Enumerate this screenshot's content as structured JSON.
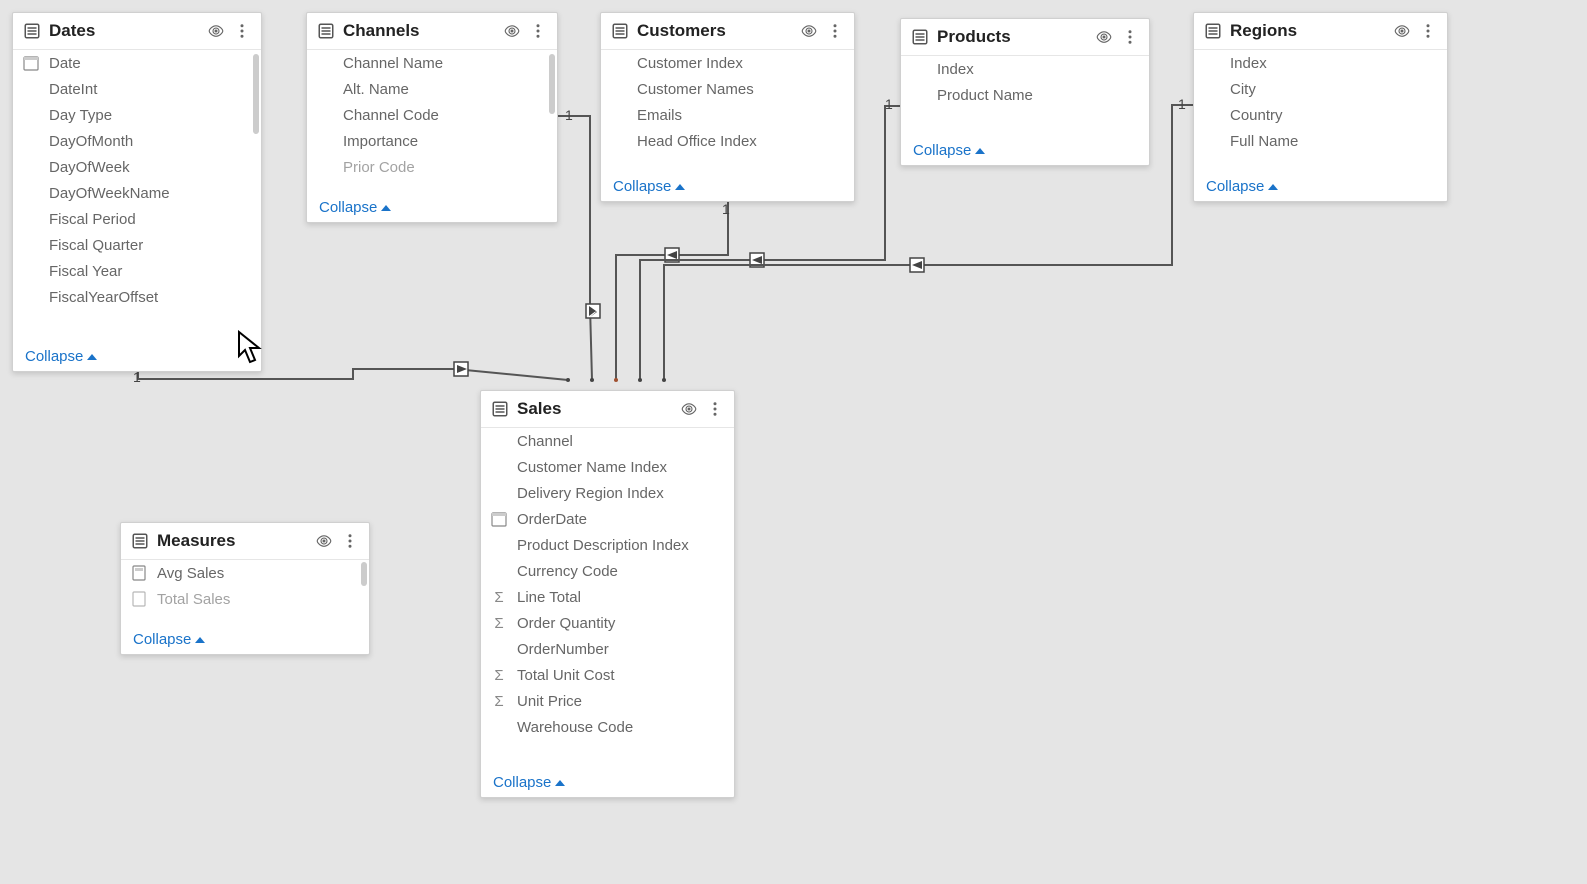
{
  "collapse_label": "Collapse",
  "tables": {
    "dates": {
      "title": "Dates",
      "fields": [
        "Date",
        "DateInt",
        "Day Type",
        "DayOfMonth",
        "DayOfWeek",
        "DayOfWeekName",
        "Fiscal Period",
        "Fiscal Quarter",
        "Fiscal Year",
        "FiscalYearOffset"
      ]
    },
    "channels": {
      "title": "Channels",
      "fields": [
        "Channel Name",
        "Alt. Name",
        "Channel Code",
        "Importance",
        "Prior Code"
      ]
    },
    "customers": {
      "title": "Customers",
      "fields": [
        "Customer Index",
        "Customer Names",
        "Emails",
        "Head Office Index"
      ]
    },
    "products": {
      "title": "Products",
      "fields": [
        "Index",
        "Product Name"
      ]
    },
    "regions": {
      "title": "Regions",
      "fields": [
        "Index",
        "City",
        "Country",
        "Full Name"
      ]
    },
    "sales": {
      "title": "Sales",
      "fields": [
        "Channel",
        "Customer Name Index",
        "Delivery Region Index",
        "OrderDate",
        "Product Description Index",
        "Currency Code",
        "Line Total",
        "Order Quantity",
        "OrderNumber",
        "Total Unit Cost",
        "Unit Price",
        "Warehouse Code"
      ]
    },
    "measures": {
      "title": "Measures",
      "fields": [
        "Avg Sales",
        "Total Sales"
      ]
    }
  },
  "relationships": [
    {
      "from": "dates",
      "to": "sales",
      "from_card": "1",
      "to_card": "*"
    },
    {
      "from": "channels",
      "to": "sales",
      "from_card": "1",
      "to_card": "*"
    },
    {
      "from": "customers",
      "to": "sales",
      "from_card": "1",
      "to_card": "*"
    },
    {
      "from": "products",
      "to": "sales",
      "from_card": "1",
      "to_card": "*"
    },
    {
      "from": "regions",
      "to": "sales",
      "from_card": "1",
      "to_card": "*"
    }
  ]
}
